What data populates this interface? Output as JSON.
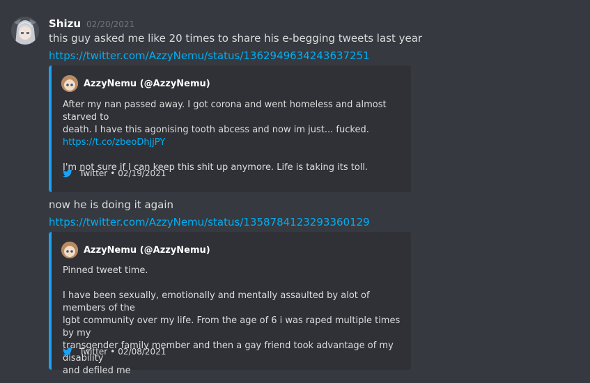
{
  "message": {
    "username": "Shizu",
    "timestamp": "02/20/2021",
    "avatar_icon": "anime-avatar-icon",
    "text_1": "this guy asked me like 20 times to share his e-begging tweets last year",
    "link_1": "https://twitter.com/AzzyNemu/status/1362949634243637251",
    "text_2": "now he is doing it again",
    "link_2": "https://twitter.com/AzzyNemu/status/1358784123293360129"
  },
  "embeds": [
    {
      "author": "AzzyNemu (@AzzyNemu)",
      "line_1": "After my nan passed away. I got corona and went homeless and almost starved to",
      "line_2": "death. I have this agonising tooth abcess and now im just... fucked.",
      "link": "https://t.co/zbeoDhjjPY",
      "paragraph_2": "I'm not sure if I can keep this shit up anymore. Life is taking its toll.",
      "footer_source": "Twitter",
      "footer_separator": "•",
      "footer_date": "02/19/2021"
    },
    {
      "author": "AzzyNemu (@AzzyNemu)",
      "paragraph_1": "Pinned tweet time.",
      "line_1": "I have been sexually, emotionally and mentally assaulted by alot of members of the",
      "line_2": "lgbt community over my life. From the age of 6 i was raped multiple times by my",
      "line_3": "transgender family member and then a gay friend took advantage of my disability",
      "line_4": "and defiled me",
      "footer_source": "Twitter",
      "footer_separator": "•",
      "footer_date": "02/08/2021"
    }
  ],
  "colors": {
    "background": "#36393f",
    "embed_background": "#2f3136",
    "embed_accent": "#1da1f2",
    "link": "#00aff4",
    "timestamp": "#72767d"
  }
}
